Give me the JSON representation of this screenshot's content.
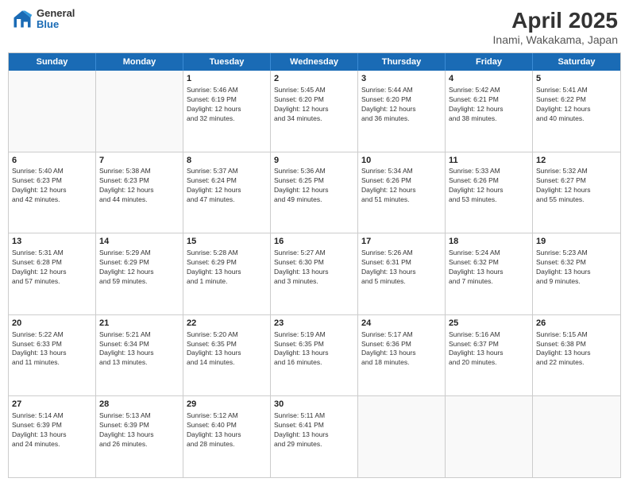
{
  "header": {
    "title": "April 2025",
    "subtitle": "Inami, Wakakama, Japan",
    "logo_line1": "General",
    "logo_line2": "Blue"
  },
  "days_of_week": [
    "Sunday",
    "Monday",
    "Tuesday",
    "Wednesday",
    "Thursday",
    "Friday",
    "Saturday"
  ],
  "weeks": [
    [
      {
        "day": "",
        "info": ""
      },
      {
        "day": "",
        "info": ""
      },
      {
        "day": "1",
        "info": "Sunrise: 5:46 AM\nSunset: 6:19 PM\nDaylight: 12 hours\nand 32 minutes."
      },
      {
        "day": "2",
        "info": "Sunrise: 5:45 AM\nSunset: 6:20 PM\nDaylight: 12 hours\nand 34 minutes."
      },
      {
        "day": "3",
        "info": "Sunrise: 5:44 AM\nSunset: 6:20 PM\nDaylight: 12 hours\nand 36 minutes."
      },
      {
        "day": "4",
        "info": "Sunrise: 5:42 AM\nSunset: 6:21 PM\nDaylight: 12 hours\nand 38 minutes."
      },
      {
        "day": "5",
        "info": "Sunrise: 5:41 AM\nSunset: 6:22 PM\nDaylight: 12 hours\nand 40 minutes."
      }
    ],
    [
      {
        "day": "6",
        "info": "Sunrise: 5:40 AM\nSunset: 6:23 PM\nDaylight: 12 hours\nand 42 minutes."
      },
      {
        "day": "7",
        "info": "Sunrise: 5:38 AM\nSunset: 6:23 PM\nDaylight: 12 hours\nand 44 minutes."
      },
      {
        "day": "8",
        "info": "Sunrise: 5:37 AM\nSunset: 6:24 PM\nDaylight: 12 hours\nand 47 minutes."
      },
      {
        "day": "9",
        "info": "Sunrise: 5:36 AM\nSunset: 6:25 PM\nDaylight: 12 hours\nand 49 minutes."
      },
      {
        "day": "10",
        "info": "Sunrise: 5:34 AM\nSunset: 6:26 PM\nDaylight: 12 hours\nand 51 minutes."
      },
      {
        "day": "11",
        "info": "Sunrise: 5:33 AM\nSunset: 6:26 PM\nDaylight: 12 hours\nand 53 minutes."
      },
      {
        "day": "12",
        "info": "Sunrise: 5:32 AM\nSunset: 6:27 PM\nDaylight: 12 hours\nand 55 minutes."
      }
    ],
    [
      {
        "day": "13",
        "info": "Sunrise: 5:31 AM\nSunset: 6:28 PM\nDaylight: 12 hours\nand 57 minutes."
      },
      {
        "day": "14",
        "info": "Sunrise: 5:29 AM\nSunset: 6:29 PM\nDaylight: 12 hours\nand 59 minutes."
      },
      {
        "day": "15",
        "info": "Sunrise: 5:28 AM\nSunset: 6:29 PM\nDaylight: 13 hours\nand 1 minute."
      },
      {
        "day": "16",
        "info": "Sunrise: 5:27 AM\nSunset: 6:30 PM\nDaylight: 13 hours\nand 3 minutes."
      },
      {
        "day": "17",
        "info": "Sunrise: 5:26 AM\nSunset: 6:31 PM\nDaylight: 13 hours\nand 5 minutes."
      },
      {
        "day": "18",
        "info": "Sunrise: 5:24 AM\nSunset: 6:32 PM\nDaylight: 13 hours\nand 7 minutes."
      },
      {
        "day": "19",
        "info": "Sunrise: 5:23 AM\nSunset: 6:32 PM\nDaylight: 13 hours\nand 9 minutes."
      }
    ],
    [
      {
        "day": "20",
        "info": "Sunrise: 5:22 AM\nSunset: 6:33 PM\nDaylight: 13 hours\nand 11 minutes."
      },
      {
        "day": "21",
        "info": "Sunrise: 5:21 AM\nSunset: 6:34 PM\nDaylight: 13 hours\nand 13 minutes."
      },
      {
        "day": "22",
        "info": "Sunrise: 5:20 AM\nSunset: 6:35 PM\nDaylight: 13 hours\nand 14 minutes."
      },
      {
        "day": "23",
        "info": "Sunrise: 5:19 AM\nSunset: 6:35 PM\nDaylight: 13 hours\nand 16 minutes."
      },
      {
        "day": "24",
        "info": "Sunrise: 5:17 AM\nSunset: 6:36 PM\nDaylight: 13 hours\nand 18 minutes."
      },
      {
        "day": "25",
        "info": "Sunrise: 5:16 AM\nSunset: 6:37 PM\nDaylight: 13 hours\nand 20 minutes."
      },
      {
        "day": "26",
        "info": "Sunrise: 5:15 AM\nSunset: 6:38 PM\nDaylight: 13 hours\nand 22 minutes."
      }
    ],
    [
      {
        "day": "27",
        "info": "Sunrise: 5:14 AM\nSunset: 6:39 PM\nDaylight: 13 hours\nand 24 minutes."
      },
      {
        "day": "28",
        "info": "Sunrise: 5:13 AM\nSunset: 6:39 PM\nDaylight: 13 hours\nand 26 minutes."
      },
      {
        "day": "29",
        "info": "Sunrise: 5:12 AM\nSunset: 6:40 PM\nDaylight: 13 hours\nand 28 minutes."
      },
      {
        "day": "30",
        "info": "Sunrise: 5:11 AM\nSunset: 6:41 PM\nDaylight: 13 hours\nand 29 minutes."
      },
      {
        "day": "",
        "info": ""
      },
      {
        "day": "",
        "info": ""
      },
      {
        "day": "",
        "info": ""
      }
    ]
  ]
}
